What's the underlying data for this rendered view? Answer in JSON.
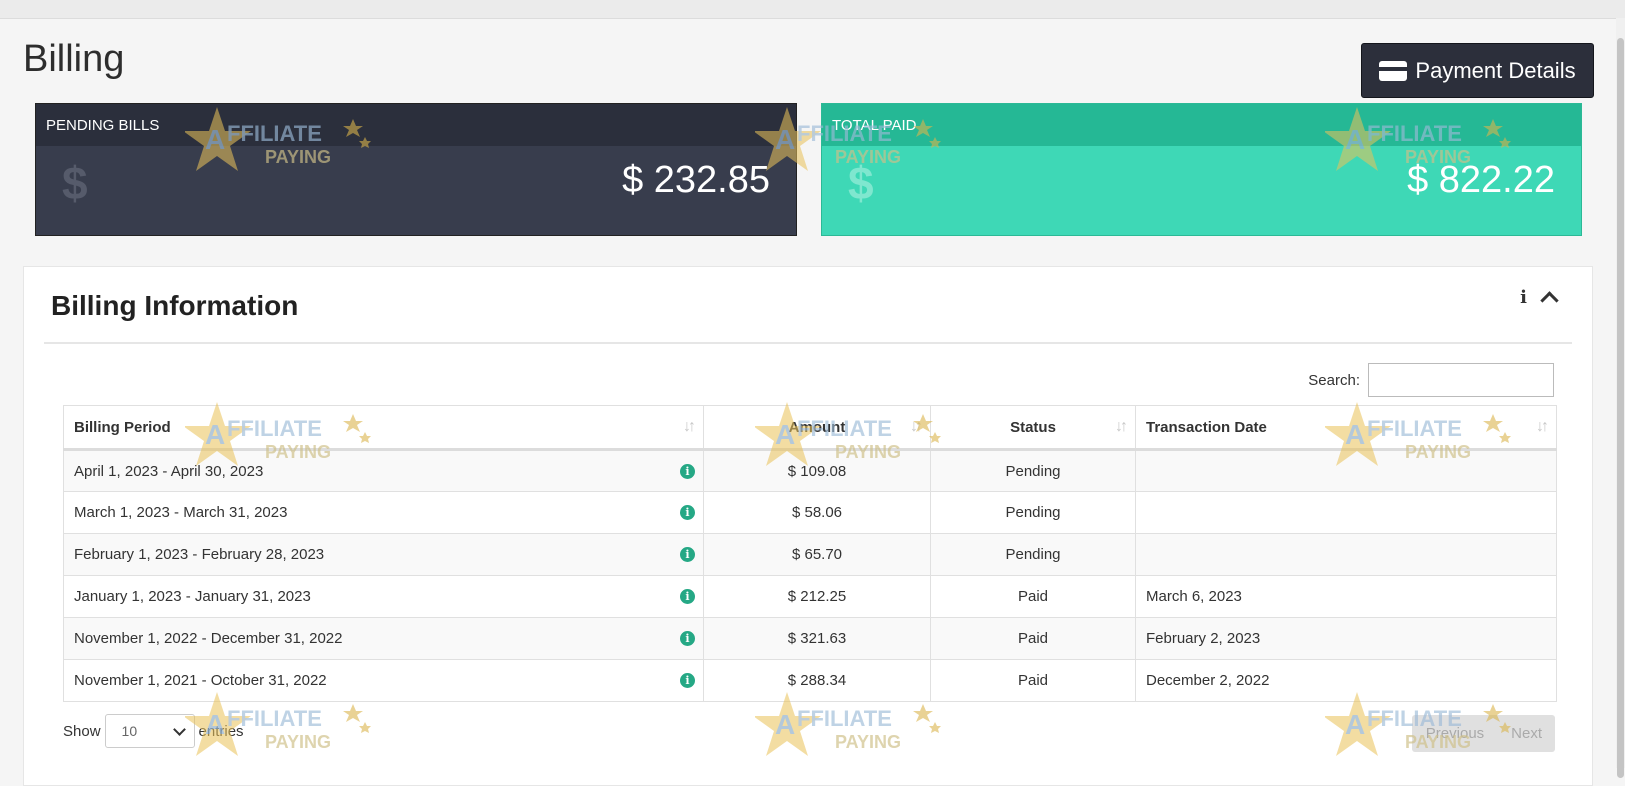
{
  "page": {
    "title": "Billing"
  },
  "header": {
    "payment_details_label": "Payment Details"
  },
  "stats": {
    "pending": {
      "label": "PENDING BILLS",
      "currency": "$",
      "amount": "$ 232.85",
      "color": "#383d4d"
    },
    "paid": {
      "label": "TOTAL PAID",
      "currency": "$",
      "amount": "$ 822.22",
      "color": "#3ed8b6"
    }
  },
  "panel": {
    "title": "Billing Information",
    "info_icon": "info-icon",
    "collapse_icon": "chevron-up-icon",
    "search_label": "Search:",
    "search_value": "",
    "columns": [
      "Billing Period",
      "Amount",
      "Status",
      "Transaction Date"
    ],
    "rows": [
      {
        "period": "April 1, 2023 - April 30, 2023",
        "amount": "$ 109.08",
        "status": "Pending",
        "date": ""
      },
      {
        "period": "March 1, 2023 - March 31, 2023",
        "amount": "$ 58.06",
        "status": "Pending",
        "date": ""
      },
      {
        "period": "February 1, 2023 - February 28, 2023",
        "amount": "$ 65.70",
        "status": "Pending",
        "date": ""
      },
      {
        "period": "January 1, 2023 - January 31, 2023",
        "amount": "$ 212.25",
        "status": "Paid",
        "date": "March 6, 2023"
      },
      {
        "period": "November 1, 2022 - December 31, 2022",
        "amount": "$ 321.63",
        "status": "Paid",
        "date": "February 2, 2023"
      },
      {
        "period": "November 1, 2021 - October 31, 2022",
        "amount": "$ 288.34",
        "status": "Paid",
        "date": "December 2, 2022"
      }
    ],
    "show_label": "Show",
    "entries_value": "10",
    "entries_label": "entries",
    "previous_label": "Previous",
    "next_label": "Next"
  },
  "watermark": {
    "line1": "FFILIATE",
    "line2": "PAYING",
    "letter": "A"
  }
}
